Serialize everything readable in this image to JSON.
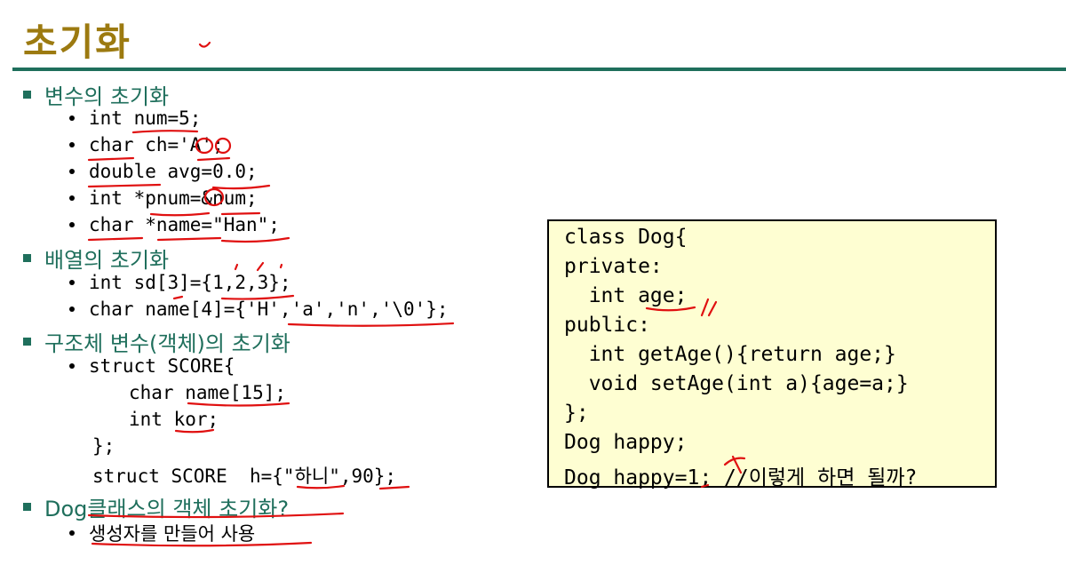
{
  "slide": {
    "title": "초기화",
    "sections": {
      "variables": {
        "heading": "변수의 초기화",
        "items": [
          "int num=5;",
          "char ch='A';",
          "double avg=0.0;",
          "int *pnum=&num;",
          "char *name=\"Han\";"
        ]
      },
      "arrays": {
        "heading": "배열의 초기화",
        "items": [
          "int sd[3]={1,2,3};",
          "char name[4]={'H','a','n','\\0'};"
        ]
      },
      "struct": {
        "heading": "구조체 변수(객체)의 초기화",
        "lines": [
          "struct SCORE{",
          "char name[15];",
          "int kor;",
          "};",
          "struct SCORE  h={\"하니\",90};"
        ]
      },
      "dog": {
        "heading": "Dog클래스의 객체 초기화?",
        "items": [
          "생성자를 만들어 사용"
        ]
      }
    },
    "code_box": {
      "lines": [
        "class Dog{",
        "private:",
        "  int age;",
        "public:",
        "  int getAge(){return age;}",
        "  void setAge(int a){age=a;}",
        "};",
        "Dog happy;",
        "Dog happy=1; //이렇게 하면 될까?"
      ]
    },
    "colors": {
      "title": "#9c7a10",
      "accent": "#1f6f5c",
      "literal": "#2020d0",
      "annotation": "#e01010",
      "code_box_bg": "#fefed2"
    }
  }
}
